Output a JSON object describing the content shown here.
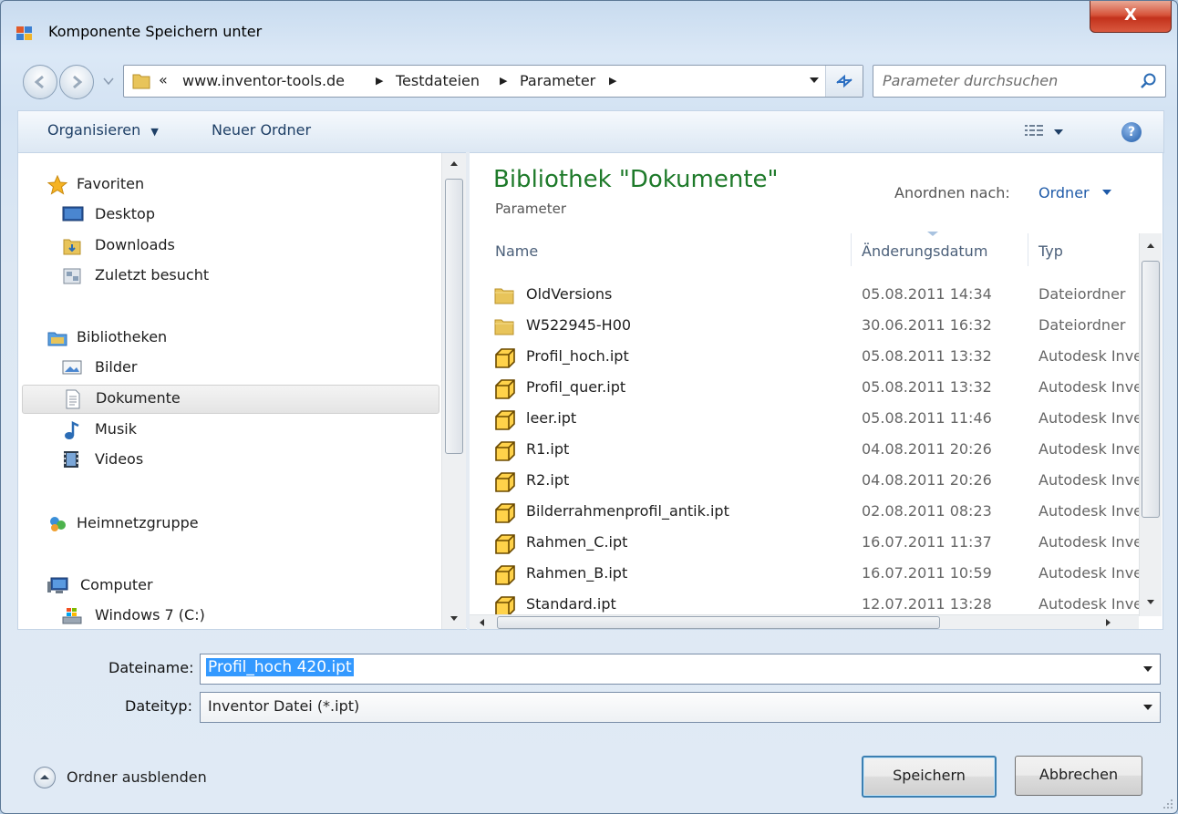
{
  "window": {
    "title": "Komponente Speichern unter",
    "close_label": "X"
  },
  "address": {
    "overflow": "«",
    "crumbs": [
      "www.inventor-tools.de",
      "Testdateien",
      "Parameter"
    ]
  },
  "search": {
    "placeholder": "Parameter durchsuchen"
  },
  "toolbar": {
    "organize_label": "Organisieren",
    "new_folder_label": "Neuer Ordner"
  },
  "nav": {
    "favorites": {
      "label": "Favoriten",
      "items": [
        "Desktop",
        "Downloads",
        "Zuletzt besucht"
      ]
    },
    "libraries": {
      "label": "Bibliotheken",
      "items": [
        "Bilder",
        "Dokumente",
        "Musik",
        "Videos"
      ],
      "selected": "Dokumente"
    },
    "homegroup": {
      "label": "Heimnetzgruppe"
    },
    "computer": {
      "label": "Computer",
      "items": [
        "Windows 7 (C:)"
      ]
    }
  },
  "library": {
    "title": "Bibliothek \"Dokumente\"",
    "subtitle": "Parameter",
    "arrange_label": "Anordnen nach:",
    "arrange_value": "Ordner"
  },
  "columns": {
    "name": "Name",
    "date": "Änderungsdatum",
    "type": "Typ"
  },
  "files": [
    {
      "name": "OldVersions",
      "date": "05.08.2011 14:34",
      "type": "Dateiordner",
      "kind": "folder"
    },
    {
      "name": "W522945-H00",
      "date": "30.06.2011 16:32",
      "type": "Dateiordner",
      "kind": "folder"
    },
    {
      "name": "Profil_hoch.ipt",
      "date": "05.08.2011 13:32",
      "type": "Autodesk Inve",
      "kind": "part"
    },
    {
      "name": "Profil_quer.ipt",
      "date": "05.08.2011 13:32",
      "type": "Autodesk Inve",
      "kind": "part"
    },
    {
      "name": "leer.ipt",
      "date": "05.08.2011 11:46",
      "type": "Autodesk Inve",
      "kind": "part"
    },
    {
      "name": "R1.ipt",
      "date": "04.08.2011 20:26",
      "type": "Autodesk Inve",
      "kind": "part"
    },
    {
      "name": "R2.ipt",
      "date": "04.08.2011 20:26",
      "type": "Autodesk Inve",
      "kind": "part"
    },
    {
      "name": "Bilderrahmenprofil_antik.ipt",
      "date": "02.08.2011 08:23",
      "type": "Autodesk Inve",
      "kind": "part"
    },
    {
      "name": "Rahmen_C.ipt",
      "date": "16.07.2011 11:37",
      "type": "Autodesk Inve",
      "kind": "part"
    },
    {
      "name": "Rahmen_B.ipt",
      "date": "16.07.2011 10:59",
      "type": "Autodesk Inve",
      "kind": "part"
    },
    {
      "name": "Standard.ipt",
      "date": "12.07.2011 13:28",
      "type": "Autodesk Inve",
      "kind": "part"
    }
  ],
  "form": {
    "filename_label": "Dateiname:",
    "filename_value": "Profil_hoch 420.ipt",
    "filetype_label": "Dateityp:",
    "filetype_value": "Inventor Datei (*.ipt)"
  },
  "footer": {
    "hide_folders_label": "Ordner ausblenden",
    "save_label": "Speichern",
    "cancel_label": "Abbrechen"
  },
  "colors": {
    "library_title": "#1e7a2a",
    "link_blue": "#1e5aa8",
    "selection": "#3399ff",
    "close_red": "#c3321c"
  }
}
